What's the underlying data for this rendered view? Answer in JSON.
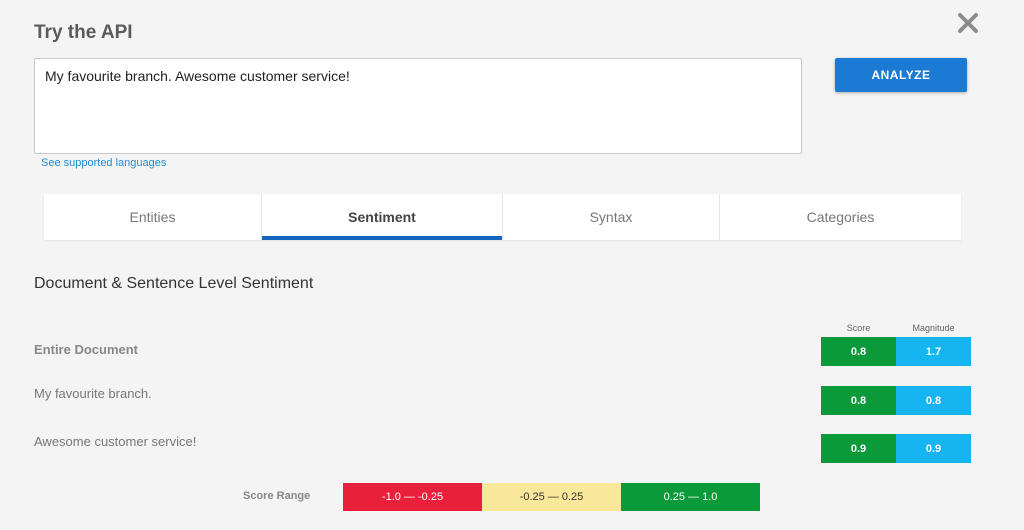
{
  "header": {
    "title": "Try the API"
  },
  "input": {
    "value": "My favourite branch. Awesome customer service!"
  },
  "actions": {
    "analyze_label": "ANALYZE"
  },
  "links": {
    "languages": "See supported languages"
  },
  "tabs": [
    {
      "label": "Entities",
      "active": false
    },
    {
      "label": "Sentiment",
      "active": true
    },
    {
      "label": "Syntax",
      "active": false
    },
    {
      "label": "Categories",
      "active": false
    }
  ],
  "sentiment": {
    "section_title": "Document & Sentence Level Sentiment",
    "columns": {
      "score": "Score",
      "magnitude": "Magnitude"
    },
    "rows": [
      {
        "label": "Entire Document",
        "score": "0.8",
        "magnitude": "1.7"
      },
      {
        "label": "My favourite branch.",
        "score": "0.8",
        "magnitude": "0.8"
      },
      {
        "label": "Awesome customer service!",
        "score": "0.9",
        "magnitude": "0.9"
      }
    ]
  },
  "score_range": {
    "label": "Score Range",
    "segments": [
      {
        "label": "-1.0 — -0.25",
        "color": "#e8203c",
        "text_color": "#ffffff"
      },
      {
        "label": "-0.25 — 0.25",
        "color": "#f9e79a",
        "text_color": "#333333"
      },
      {
        "label": "0.25 — 1.0",
        "color": "#0b9a3a",
        "text_color": "#ffffff"
      }
    ]
  },
  "icons": {
    "close": "close-icon"
  },
  "colors": {
    "accent": "#1a7ad4",
    "tab_indicator": "#1565c0",
    "score_badge": "#0b9a3a",
    "magnitude_badge": "#16b4f0",
    "link": "#1a8fd8"
  }
}
